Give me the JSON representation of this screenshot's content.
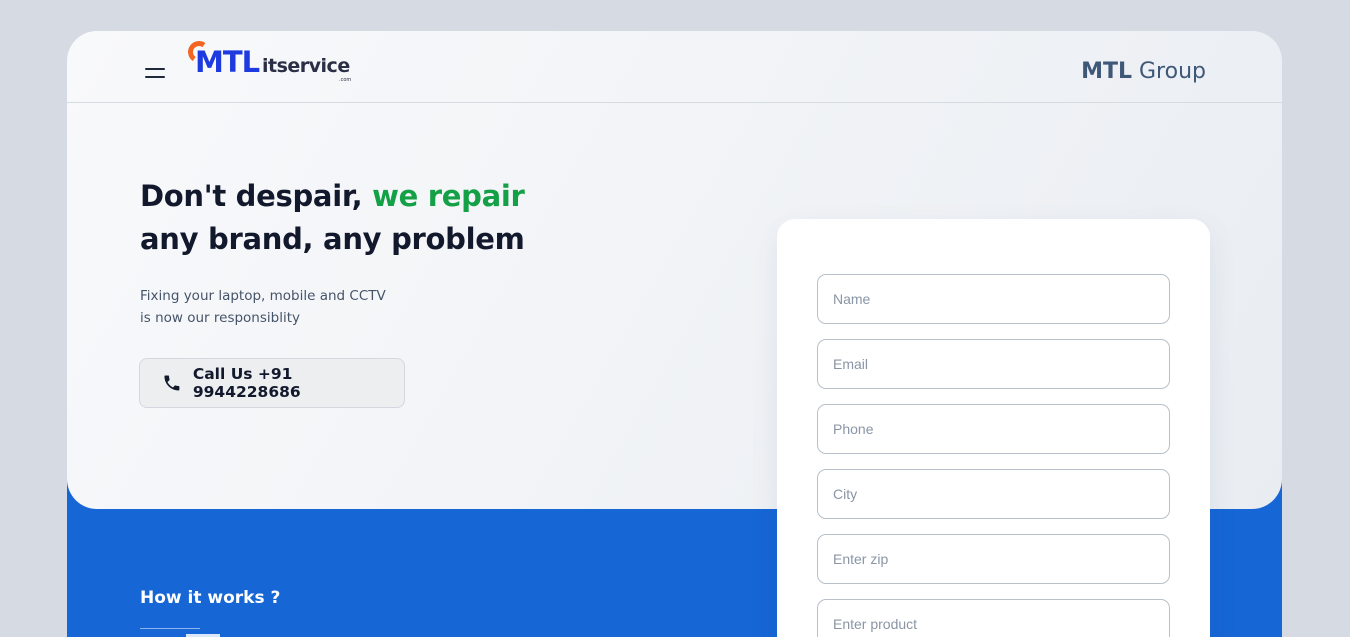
{
  "header": {
    "logo": {
      "mtl": "MTL",
      "it": "itservice",
      "suffix": ".com"
    },
    "group_bold": "MTL",
    "group_rest": " Group"
  },
  "hero": {
    "headline_part1": "Don't despair, ",
    "headline_green": "we repair",
    "headline_line2": "any brand, any problem",
    "sub_line1": "Fixing your laptop, mobile and CCTV",
    "sub_line2": "is now our responsiblity",
    "call_label": "Call Us +91 9944228686"
  },
  "how": {
    "title": "How it works ?"
  },
  "form": {
    "name_placeholder": "Name",
    "email_placeholder": "Email",
    "phone_placeholder": "Phone",
    "city_placeholder": "City",
    "zip_placeholder": "Enter zip",
    "product_placeholder": "Enter product"
  },
  "colors": {
    "accent_green": "#13a046",
    "band_blue": "#1766d6",
    "logo_orange": "#f26522",
    "logo_blue": "#1d39e0"
  },
  "icons": {
    "menu": "hamburger-icon",
    "call": "phone-icon"
  }
}
